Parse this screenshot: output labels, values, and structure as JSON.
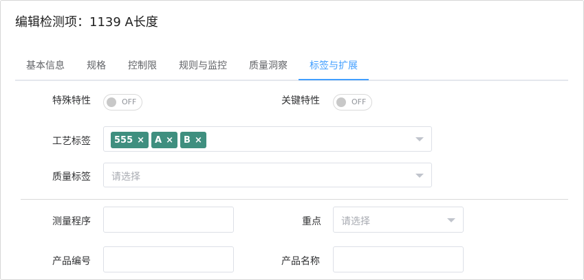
{
  "dialog": {
    "title": "编辑检测项：1139 A长度"
  },
  "tabs": [
    {
      "label": "基本信息"
    },
    {
      "label": "规格"
    },
    {
      "label": "控制限"
    },
    {
      "label": "规则与监控"
    },
    {
      "label": "质量洞察"
    },
    {
      "label": "标签与扩展"
    }
  ],
  "form": {
    "special_feature": {
      "label": "特殊特性",
      "state": "OFF"
    },
    "key_feature": {
      "label": "关键特性",
      "state": "OFF"
    },
    "process_tags": {
      "label": "工艺标签",
      "tags": [
        "555",
        "A",
        "B"
      ],
      "remove_glyph": "×"
    },
    "quality_tags": {
      "label": "质量标签",
      "placeholder": "请选择"
    },
    "measure_program": {
      "label": "测量程序",
      "value": ""
    },
    "focus": {
      "label": "重点",
      "placeholder": "请选择"
    },
    "product_code": {
      "label": "产品编号",
      "value": ""
    },
    "product_name": {
      "label": "产品名称",
      "value": ""
    }
  },
  "colors": {
    "accent": "#409eff",
    "tag_bg": "#3f8f7f"
  }
}
